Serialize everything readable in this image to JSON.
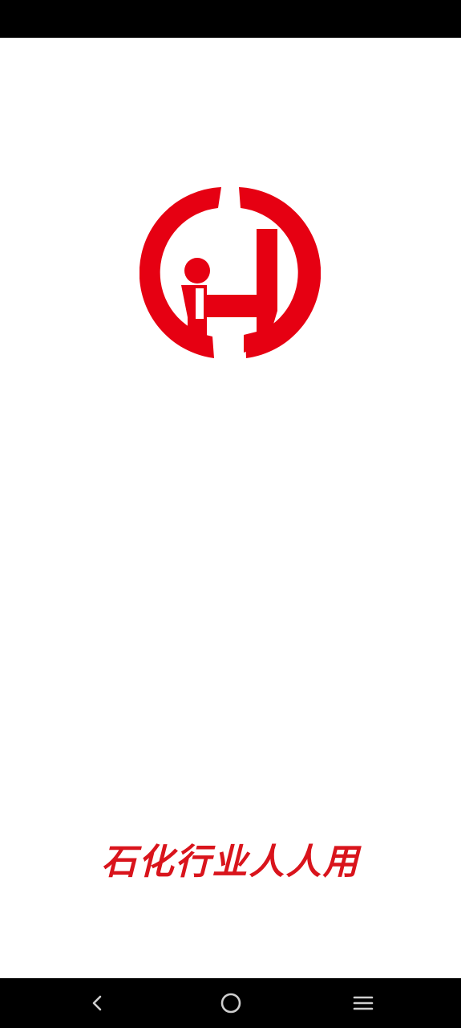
{
  "status_bar": {},
  "splash": {
    "logo": {
      "icon": "ih-circle-logo-icon",
      "brand_color": "#e60012"
    },
    "slogan": "石化行业人人用",
    "slogan_color": "#d9141c"
  },
  "nav_bar": {
    "back_icon": "chevron-left-icon",
    "home_icon": "circle-home-icon",
    "recent_icon": "menu-lines-icon",
    "icon_color": "#cfcfcf"
  }
}
